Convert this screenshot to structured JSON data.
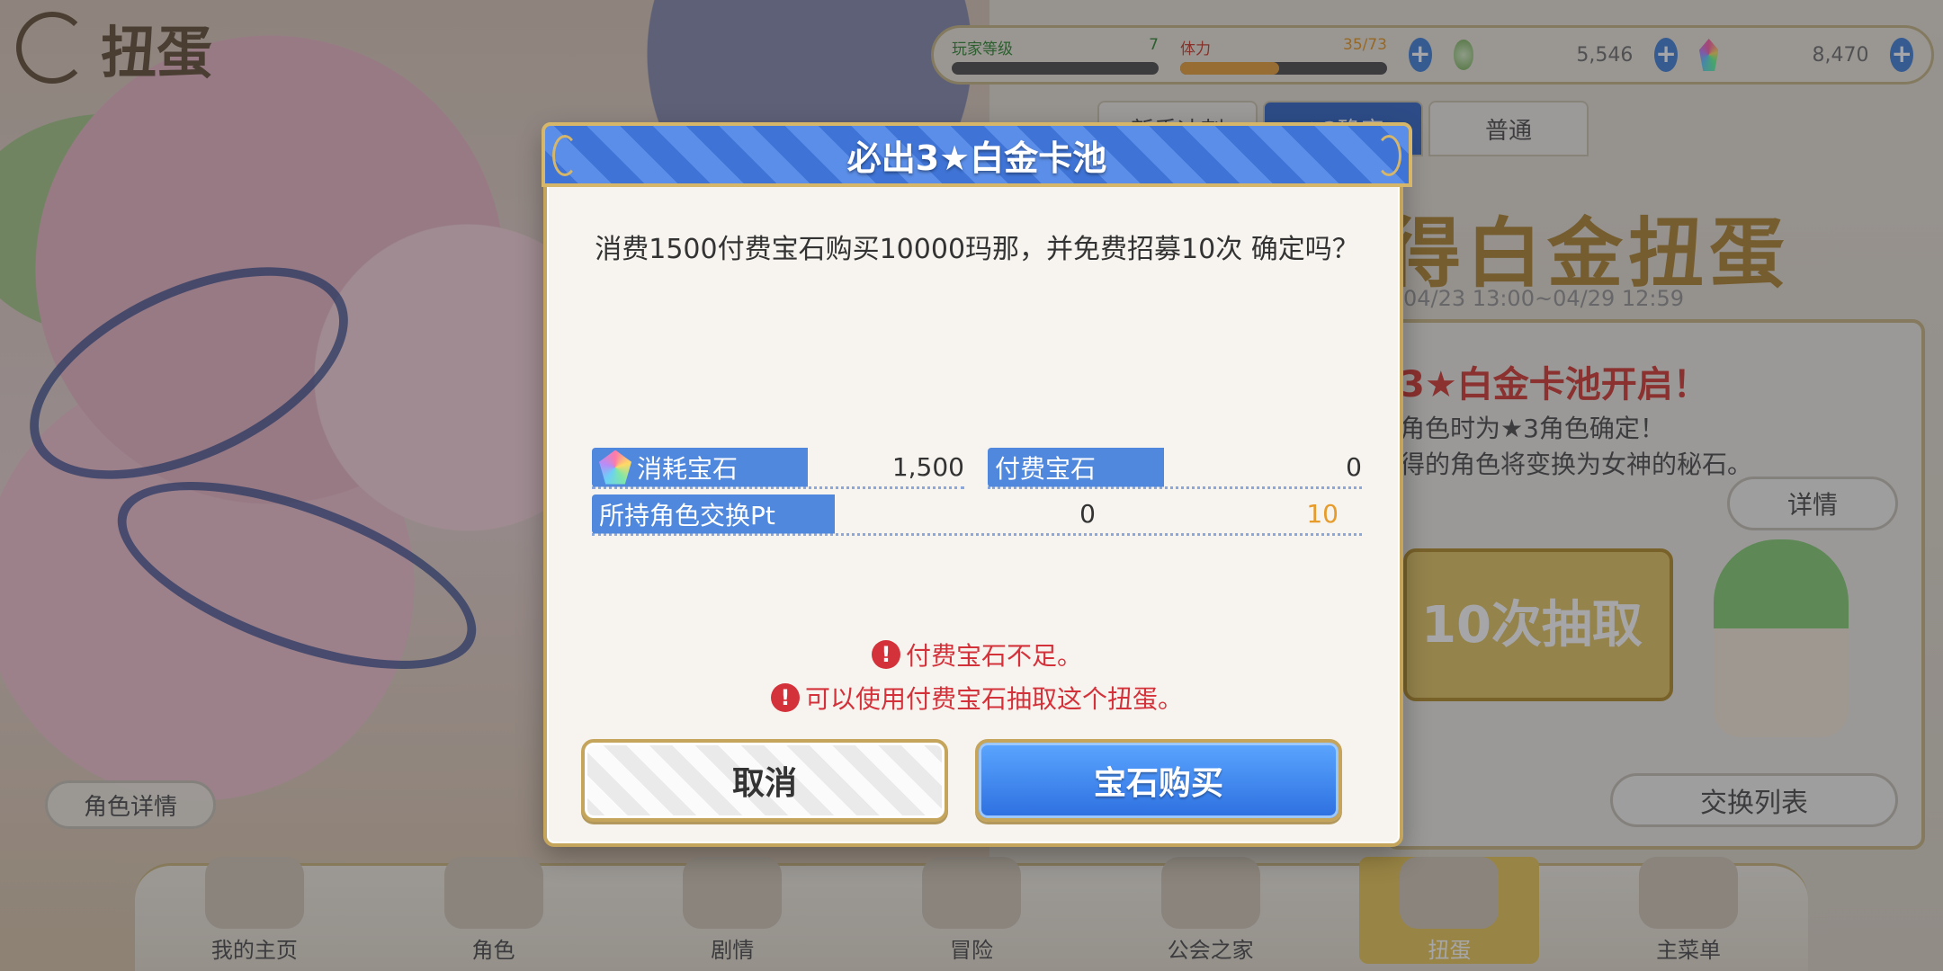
{
  "top": {
    "brand_title": "扭蛋",
    "level_label": "玩家等级",
    "level_value": "7",
    "stamina_label": "体力",
    "stamina_value": "35/73",
    "stamina_fill": 0.48,
    "mana_value": "5,546",
    "gem_value": "8,470"
  },
  "tabs": [
    {
      "label": "新手冲刺"
    },
    {
      "label": "★3确定"
    },
    {
      "label": "普通"
    }
  ],
  "banner": {
    "title": "得白金扭蛋",
    "date": "04/23 13:00~04/29 12:59",
    "headline": "3★白金卡池开启！",
    "line1": "角色时为★3角色确定！",
    "line2": "得的角色将变换为女神的秘石。",
    "detail_label": "详情",
    "draw_label": "10次抽取",
    "draw_cost": "1500",
    "exchange_label": "交换列表",
    "char_detail_label": "角色详情"
  },
  "bottom_nav": [
    {
      "label": "我的主页"
    },
    {
      "label": "角色"
    },
    {
      "label": "剧情"
    },
    {
      "label": "冒险"
    },
    {
      "label": "公会之家"
    },
    {
      "label": "扭蛋"
    },
    {
      "label": "主菜单"
    }
  ],
  "dialog": {
    "title": "必出3★白金卡池",
    "message": "消费1500付费宝石购买10000玛那，并免费招募10次 确定吗？",
    "consume_label": "消耗宝石",
    "consume_value": "1,500",
    "paid_label": "付费宝石",
    "paid_value": "0",
    "pt_label": "所持角色交换Pt",
    "pt_value": "0",
    "pt_after": "10",
    "warning1": "付费宝石不足。",
    "warning2": "可以使用付费宝石抽取这个扭蛋。",
    "cancel_label": "取消",
    "buy_label": "宝石购买"
  },
  "colors": {
    "accent_blue": "#3f74d6",
    "gold_border": "#c5a45b",
    "warning_red": "#d4323b",
    "orange_value": "#e79b2a"
  }
}
